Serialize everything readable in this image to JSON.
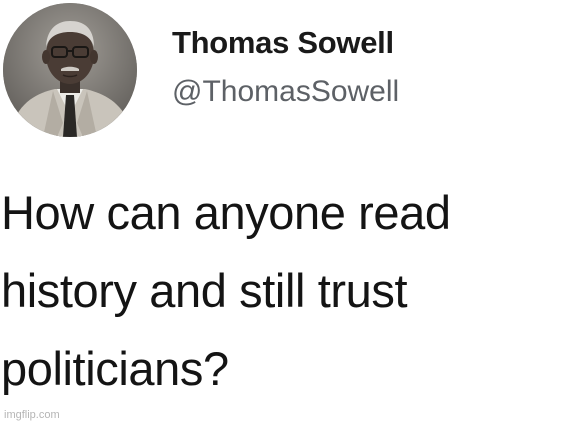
{
  "tweet": {
    "author": {
      "display_name": "Thomas Sowell",
      "handle": "@ThomasSowell",
      "avatar_icon": "profile-photo-avatar"
    },
    "text_lines": [
      "How can anyone read",
      "history and still trust",
      "politicians?"
    ]
  },
  "watermark": {
    "text": "imgflip.com"
  },
  "colors": {
    "background": "#ffffff",
    "text": "#141414",
    "handle": "#5d6166",
    "watermark": "#b5b5b5"
  }
}
